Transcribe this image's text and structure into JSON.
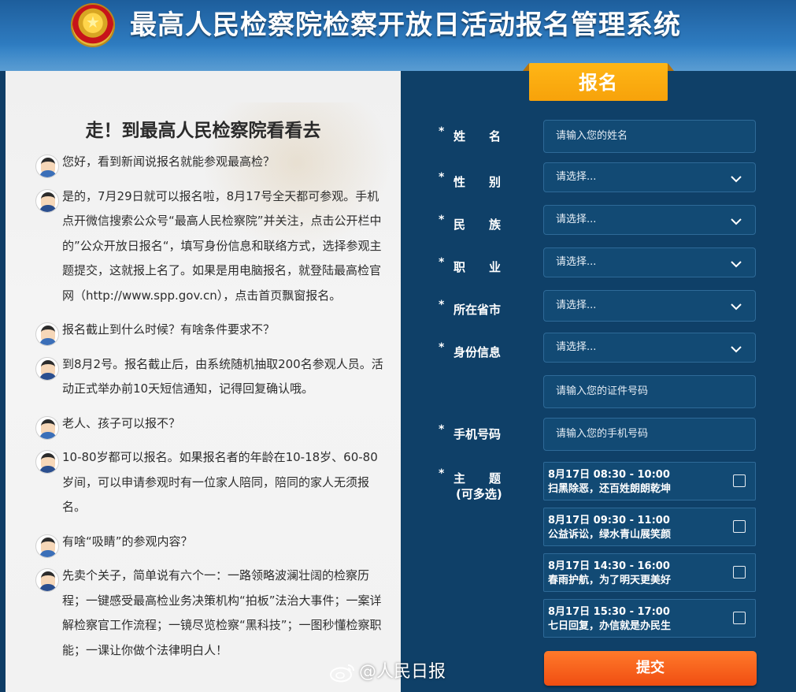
{
  "header": {
    "title": "最高人民检察院检察开放日活动报名管理系统",
    "emblem_icon": "national-emblem-icon"
  },
  "left": {
    "title": "走！到最高人民检察院看看去",
    "messages": [
      {
        "role": "q",
        "text": "您好，看到新闻说报名就能参观最高检？"
      },
      {
        "role": "a",
        "text": "是的，7月29日就可以报名啦，8月17号全天都可参观。手机点开微信搜索公众号“最高人民检察院”并关注，点击公开栏中的”公众开放日报名“，填写身份信息和联络方式，选择参观主题提交，这就报上名了。如果是用电脑报名，就登陆最高检官网（http://www.spp.gov.cn），点击首页飘窗报名。"
      },
      {
        "role": "q",
        "text": "报名截止到什么时候？有啥条件要求不？"
      },
      {
        "role": "a",
        "text": "到8月2号。报名截止后，由系统随机抽取200名参观人员。活动正式举办前10天短信通知，记得回复确认哦。"
      },
      {
        "role": "q",
        "text": "老人、孩子可以报不？"
      },
      {
        "role": "a",
        "text": "10-80岁都可以报名。如果报名者的年龄在10-18岁、60-80岁间，可以申请参观时有一位家人陪同，陪同的家人无须报名。"
      },
      {
        "role": "q",
        "text": "有啥“吸睛”的参观内容？"
      },
      {
        "role": "a",
        "text": "先卖个关子，简单说有六个一：一路领略波澜壮阔的检察历程；一键感受最高检业务决策机构“拍板”法治大事件；一案详解检察官工作流程；一镜尽览检察“黑科技”；一图秒懂检察职能；一课让你做个法律明白人！"
      }
    ]
  },
  "form": {
    "tab_label": "报名",
    "required_mark": "*",
    "name": {
      "label": "姓　　名",
      "placeholder": "请输入您的姓名"
    },
    "gender": {
      "label": "性　　别",
      "value": "请选择..."
    },
    "ethnicity": {
      "label": "民　　族",
      "value": "请选择..."
    },
    "occupation": {
      "label": "职　　业",
      "value": "请选择..."
    },
    "province": {
      "label": "所在省市",
      "value": "请选择..."
    },
    "id_info": {
      "label": "身份信息",
      "value": "请选择...",
      "number_placeholder": "请输入您的证件号码"
    },
    "phone": {
      "label": "手机号码",
      "placeholder": "请输入您的手机号码"
    },
    "topics": {
      "label": "主　　题",
      "sublabel": "(可多选)",
      "items": [
        {
          "time": "8月17日 08:30 - 10:00",
          "title": "扫黑除恶，还百姓朗朗乾坤",
          "checked": false
        },
        {
          "time": "8月17日 09:30 - 11:00",
          "title": "公益诉讼，绿水青山展笑颜",
          "checked": false
        },
        {
          "time": "8月17日 14:30 - 16:00",
          "title": "春雨护航，为了明天更美好",
          "checked": false
        },
        {
          "time": "8月17日 15:30 - 17:00",
          "title": "七日回复，办信就是办民生",
          "checked": false
        }
      ]
    },
    "submit_label": "提交"
  },
  "watermark": {
    "text": "@人民日报",
    "icon": "weibo-icon"
  }
}
